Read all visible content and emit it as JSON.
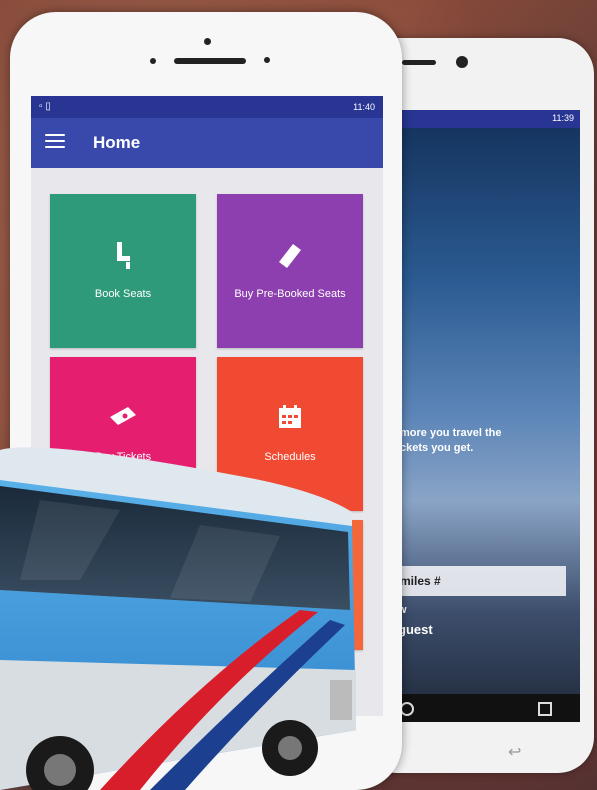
{
  "front_phone": {
    "status_time": "11:40",
    "app_title": "Home",
    "tiles": [
      {
        "label": "Book Seats",
        "icon": "seat-icon",
        "color": "#2e9a7a"
      },
      {
        "label": "Buy Pre-Booked Seats",
        "icon": "ticket-icon",
        "color": "#8d3fb0"
      },
      {
        "label": "Buy Tickets",
        "icon": "tickets-icon",
        "color": "#e61e6f"
      },
      {
        "label": "Schedules",
        "icon": "calendar-icon",
        "color": "#f04a32"
      },
      {
        "label": "",
        "icon": "",
        "color": "#f4673b"
      }
    ],
    "appbar_color": "#3949ab",
    "statusbar_color": "#283593"
  },
  "back_phone": {
    "status_time": "11:39",
    "promo_line1": "more you travel the",
    "promo_line2": "ckets you get.",
    "miles_field": "miles #",
    "line_w": "w",
    "guest_text": "guest"
  }
}
